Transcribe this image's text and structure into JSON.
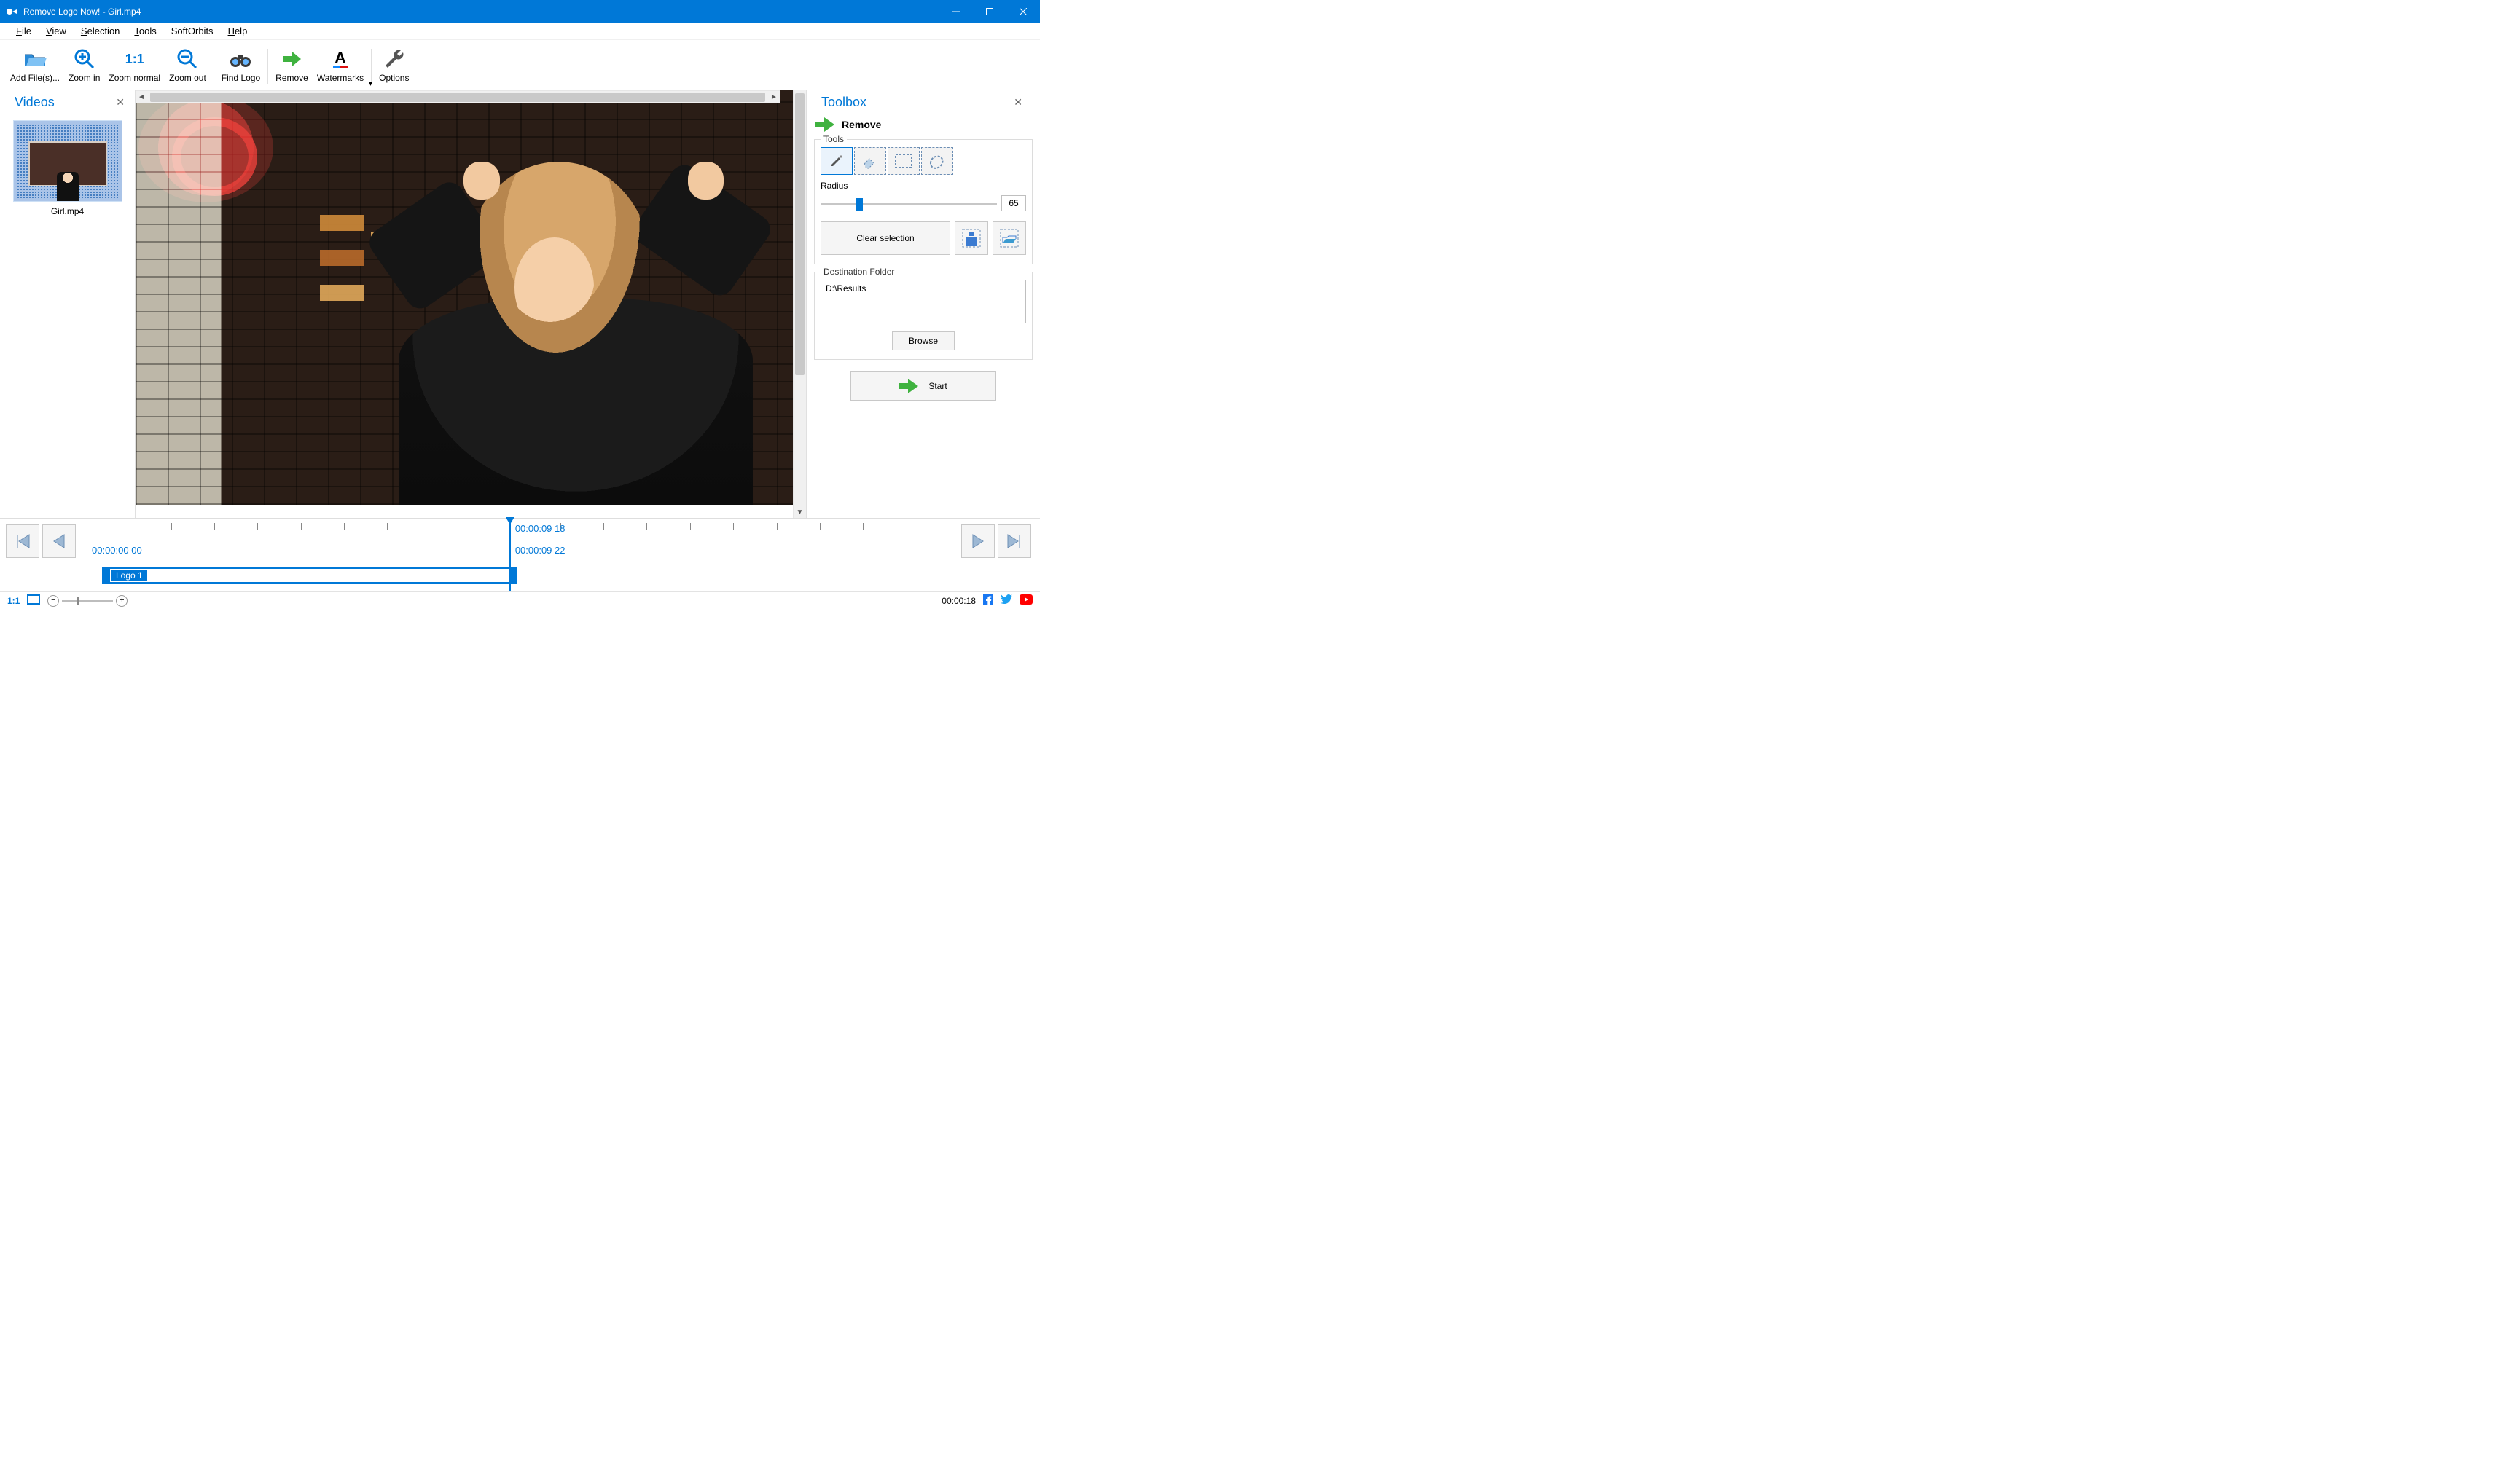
{
  "titlebar": {
    "title": "Remove Logo Now! - Girl.mp4"
  },
  "menu": {
    "file": "File",
    "file_underline": "F",
    "view": "View",
    "view_underline": "V",
    "selection": "Selection",
    "selection_underline": "S",
    "tools": "Tools",
    "tools_underline": "T",
    "softorbits": "SoftOrbits",
    "help": "Help",
    "help_underline": "H"
  },
  "toolbar": {
    "add_files": "Add File(s)...",
    "zoom_in": "Zoom in",
    "zoom_normal": "Zoom normal",
    "zoom_out": "Zoom out",
    "find_logo": "Find Logo",
    "remove": "Remove",
    "watermarks": "Watermarks",
    "options": "Options"
  },
  "videos_panel": {
    "title": "Videos",
    "items": [
      {
        "name": "Girl.mp4"
      }
    ]
  },
  "toolbox": {
    "title": "Toolbox",
    "section": "Remove",
    "tools_legend": "Tools",
    "radius_label": "Radius",
    "radius_value": "65",
    "clear_selection": "Clear selection",
    "dest_legend": "Destination Folder",
    "dest_path": "D:\\Results",
    "browse": "Browse",
    "start": "Start"
  },
  "timeline": {
    "playhead_label": "00:00:09 18",
    "start_label": "00:00:00 00",
    "current_label": "00:00:09 22",
    "logo_track_label": "Logo 1"
  },
  "statusbar": {
    "ratio": "1:1",
    "duration": "00:00:18"
  }
}
